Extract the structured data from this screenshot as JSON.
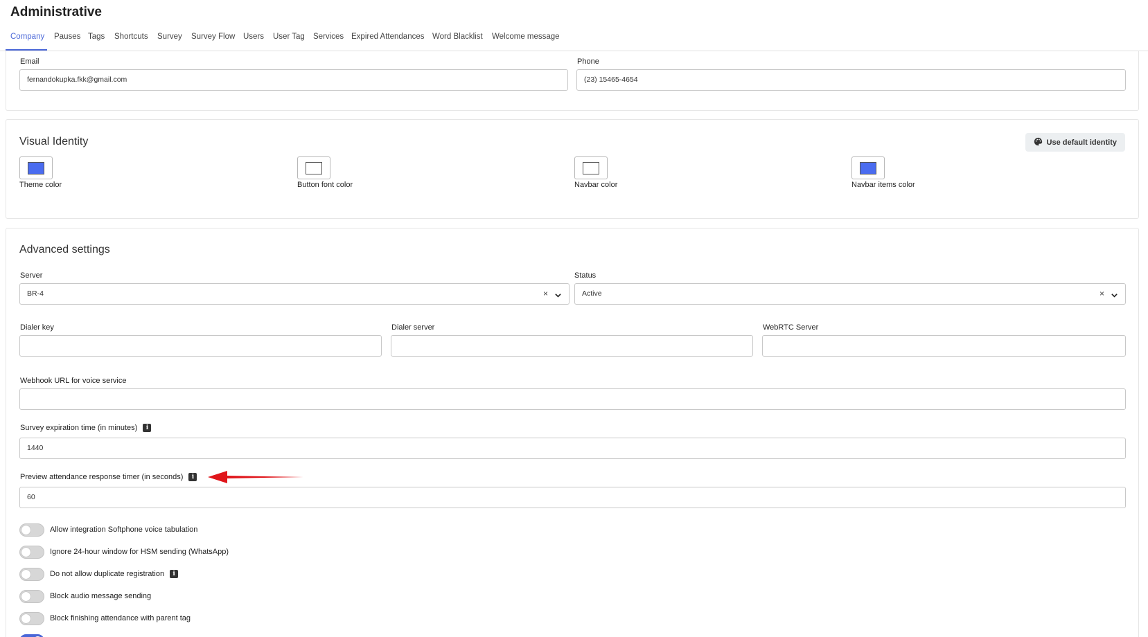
{
  "header": {
    "title": "Administrative"
  },
  "tabs": [
    {
      "label": "Company",
      "active": true
    },
    {
      "label": "Pauses"
    },
    {
      "label": "Tags"
    },
    {
      "label": "Shortcuts"
    },
    {
      "label": "Survey"
    },
    {
      "label": "Survey Flow"
    },
    {
      "label": "Users"
    },
    {
      "label": "User Tag"
    },
    {
      "label": "Services"
    },
    {
      "label": "Expired Attendances"
    },
    {
      "label": "Word Blacklist"
    },
    {
      "label": "Welcome message"
    }
  ],
  "contact": {
    "email_label": "Email",
    "email_value": "fernandokupka.fkk@gmail.com",
    "phone_label": "Phone",
    "phone_value": "(23) 15465-4654"
  },
  "visual_identity": {
    "title": "Visual Identity",
    "default_button": "Use default identity",
    "swatches": [
      {
        "label": "Theme color",
        "color": "#4a6cf0"
      },
      {
        "label": "Button font color",
        "color": "#ffffff"
      },
      {
        "label": "Navbar color",
        "color": "#ffffff"
      },
      {
        "label": "Navbar items color",
        "color": "#4a6cf0"
      }
    ]
  },
  "advanced": {
    "title": "Advanced settings",
    "server_label": "Server",
    "server_value": "BR-4",
    "status_label": "Status",
    "status_value": "Active",
    "dialer_key_label": "Dialer key",
    "dialer_key_value": "",
    "dialer_server_label": "Dialer server",
    "dialer_server_value": "",
    "webrtc_label": "WebRTC Server",
    "webrtc_value": "",
    "webhook_label": "Webhook URL for voice service",
    "webhook_value": "",
    "survey_exp_label": "Survey expiration time (in minutes)",
    "survey_exp_value": "1440",
    "preview_timer_label": "Preview attendance response timer (in seconds)",
    "preview_timer_value": "60",
    "toggles": [
      {
        "label": "Allow integration Softphone voice tabulation",
        "on": false
      },
      {
        "label": "Ignore 24-hour window for HSM sending (WhatsApp)",
        "on": false
      },
      {
        "label": "Do not allow duplicate registration",
        "on": false,
        "info": true
      },
      {
        "label": "Block audio message sending",
        "on": false
      },
      {
        "label": "Block finishing attendance with parent tag",
        "on": false
      }
    ]
  },
  "colors": {
    "accent": "#4a67d8",
    "annotation_arrow": "#e0161b"
  },
  "icons": {
    "info": "info-icon",
    "palette": "palette-icon",
    "clear": "clear-icon",
    "chevron": "chevron-down-icon",
    "arrow": "annotation-arrow-icon"
  }
}
